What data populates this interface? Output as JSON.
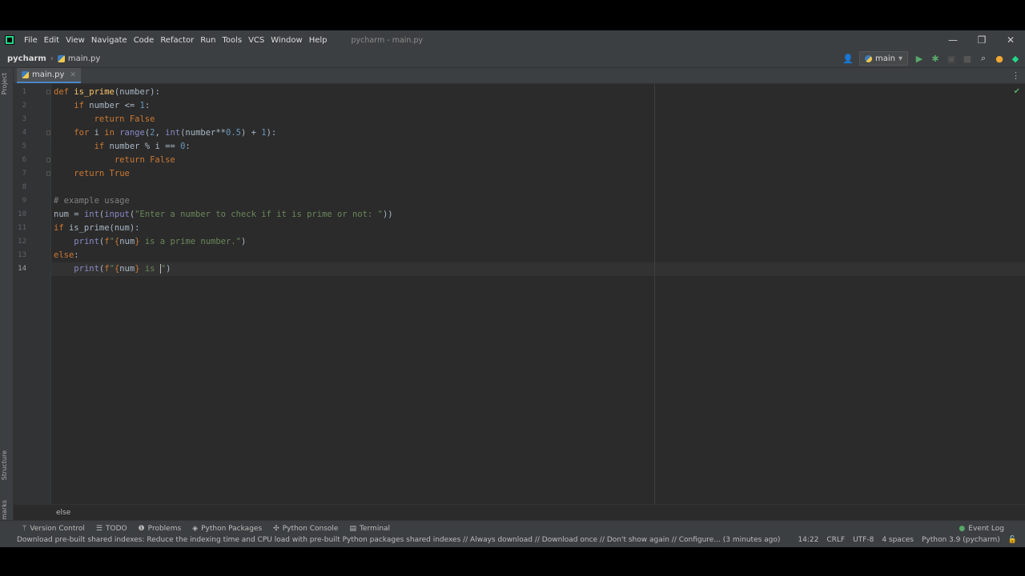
{
  "menubar": {
    "items": [
      "File",
      "Edit",
      "View",
      "Navigate",
      "Code",
      "Refactor",
      "Run",
      "Tools",
      "VCS",
      "Window",
      "Help"
    ],
    "window_title": "pycharm - main.py"
  },
  "navbar": {
    "project": "pycharm",
    "file": "main.py",
    "run_config": "main"
  },
  "editor_tab": {
    "label": "main.py"
  },
  "left_tools": {
    "project": "Project",
    "structure": "Structure",
    "bookmarks": "Bookmarks"
  },
  "gutter": {
    "line_numbers": [
      "1",
      "2",
      "3",
      "4",
      "5",
      "6",
      "7",
      "8",
      "9",
      "10",
      "11",
      "12",
      "13",
      "14"
    ],
    "current_line": 14
  },
  "code_lines": [
    [
      [
        "kw",
        "def "
      ],
      [
        "fn",
        "is_prime"
      ],
      [
        "",
        "(number):"
      ]
    ],
    [
      [
        "",
        "    "
      ],
      [
        "kw",
        "if "
      ],
      [
        "",
        "number <= "
      ],
      [
        "num",
        "1"
      ],
      [
        "",
        ":"
      ]
    ],
    [
      [
        "",
        "        "
      ],
      [
        "kw",
        "return False"
      ]
    ],
    [
      [
        "",
        "    "
      ],
      [
        "kw",
        "for "
      ],
      [
        "",
        "i "
      ],
      [
        "kw",
        "in "
      ],
      [
        "bi",
        "range"
      ],
      [
        "",
        "("
      ],
      [
        "num",
        "2"
      ],
      [
        "",
        ", "
      ],
      [
        "bi",
        "int"
      ],
      [
        "",
        "(number**"
      ],
      [
        "num",
        "0.5"
      ],
      [
        "",
        ") + "
      ],
      [
        "num",
        "1"
      ],
      [
        "",
        "):"
      ]
    ],
    [
      [
        "",
        "        "
      ],
      [
        "kw",
        "if "
      ],
      [
        "",
        "number % i == "
      ],
      [
        "num",
        "0"
      ],
      [
        "",
        ":"
      ]
    ],
    [
      [
        "",
        "            "
      ],
      [
        "kw",
        "return False"
      ]
    ],
    [
      [
        "",
        "    "
      ],
      [
        "kw",
        "return True"
      ]
    ],
    [],
    [
      [
        "cmt",
        "# example usage"
      ]
    ],
    [
      [
        "",
        "num = "
      ],
      [
        "bi",
        "int"
      ],
      [
        "",
        "("
      ],
      [
        "bi",
        "input"
      ],
      [
        "",
        "("
      ],
      [
        "str",
        "\"Enter a number to check if it is prime or not: \""
      ],
      [
        "",
        "))"
      ]
    ],
    [
      [
        "kw",
        "if "
      ],
      [
        "",
        "is_prime(num):"
      ]
    ],
    [
      [
        "",
        "    "
      ],
      [
        "bi",
        "print"
      ],
      [
        "",
        "("
      ],
      [
        "fx",
        "f"
      ],
      [
        "str",
        "\""
      ],
      [
        "fx",
        "{"
      ],
      [
        "",
        "num"
      ],
      [
        "fx",
        "}"
      ],
      [
        "str",
        " is a prime number.\""
      ],
      [
        "",
        ")"
      ]
    ],
    [
      [
        "kw",
        "else"
      ],
      [
        "",
        ":"
      ]
    ],
    [
      [
        "",
        "    "
      ],
      [
        "bi",
        "print"
      ],
      [
        "",
        "("
      ],
      [
        "fx",
        "f"
      ],
      [
        "str",
        "\""
      ],
      [
        "fx",
        "{"
      ],
      [
        "",
        "num"
      ],
      [
        "fx",
        "}"
      ],
      [
        "str",
        " is "
      ],
      [
        "caret",
        ""
      ],
      [
        "str",
        "\""
      ],
      [
        "",
        ")"
      ]
    ]
  ],
  "breadcrumb": {
    "context": "else"
  },
  "toolwindows": {
    "items": [
      "Version Control",
      "TODO",
      "Problems",
      "Python Packages",
      "Python Console",
      "Terminal"
    ],
    "event_log": "Event Log"
  },
  "status": {
    "message": "Download pre-built shared indexes: Reduce the indexing time and CPU load with pre-built Python packages shared indexes // Always download // Download once // Don't show again // Configure... (3 minutes ago)",
    "position": "14:22",
    "line_sep": "CRLF",
    "encoding": "UTF-8",
    "indent": "4 spaces",
    "interpreter": "Python 3.9 (pycharm)"
  },
  "colors": {
    "keyword": "#cc7832",
    "function": "#ffc66d",
    "number": "#6897bb",
    "string": "#6a8759",
    "comment": "#808080",
    "builtin": "#8888c6",
    "accent": "#4a88c7"
  }
}
